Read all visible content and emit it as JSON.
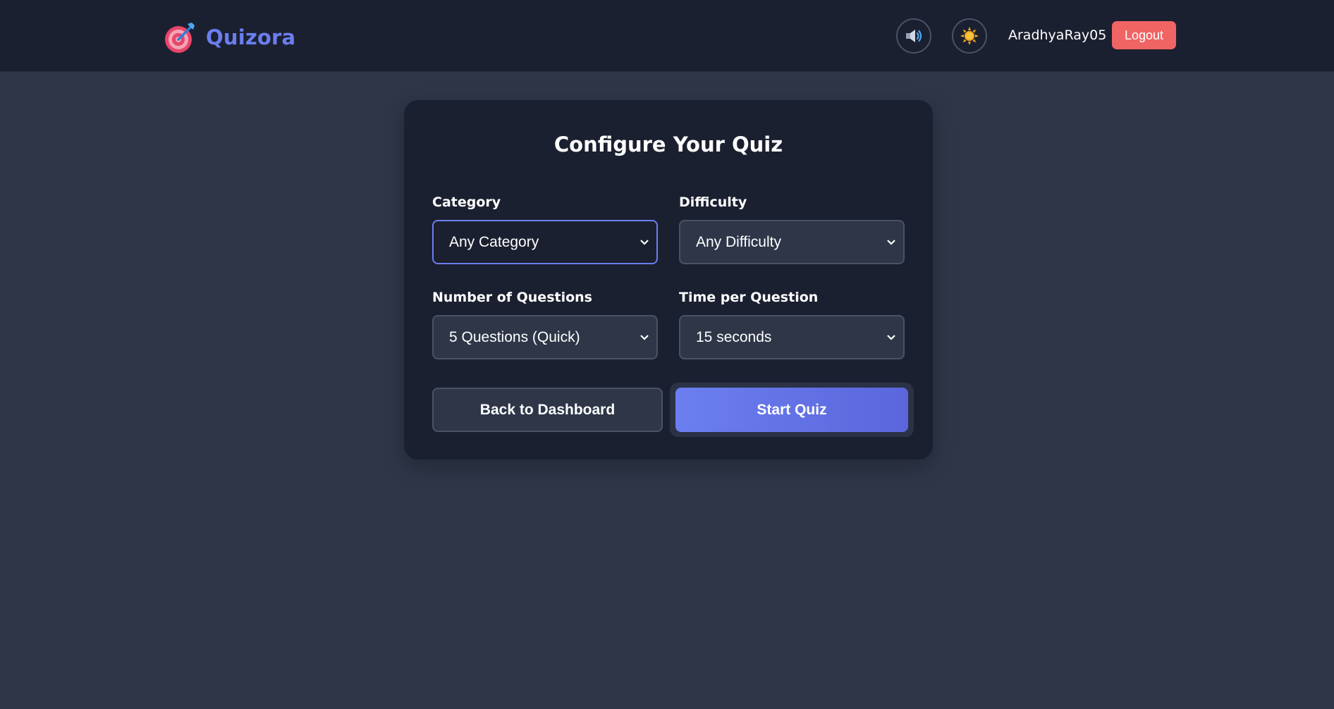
{
  "header": {
    "brand_name": "Quizora",
    "brand_icon": "target-dart-icon",
    "sound_icon": "speaker-icon",
    "theme_icon": "sun-icon",
    "username": "AradhyaRay05",
    "logout_label": "Logout"
  },
  "config": {
    "title": "Configure Your Quiz",
    "fields": {
      "category": {
        "label": "Category",
        "value": "Any Category"
      },
      "difficulty": {
        "label": "Difficulty",
        "value": "Any Difficulty"
      },
      "num_questions": {
        "label": "Number of Questions",
        "value": "5 Questions (Quick)"
      },
      "time_per_question": {
        "label": "Time per Question",
        "value": "15 seconds"
      }
    },
    "back_label": "Back to Dashboard",
    "start_label": "Start Quiz"
  },
  "colors": {
    "page_bg": "#2e3648",
    "header_bg": "#1b2030",
    "card_bg": "#1b2030",
    "accent": "#6b7ef0",
    "logout": "#f06463",
    "border": "#4a5266"
  }
}
